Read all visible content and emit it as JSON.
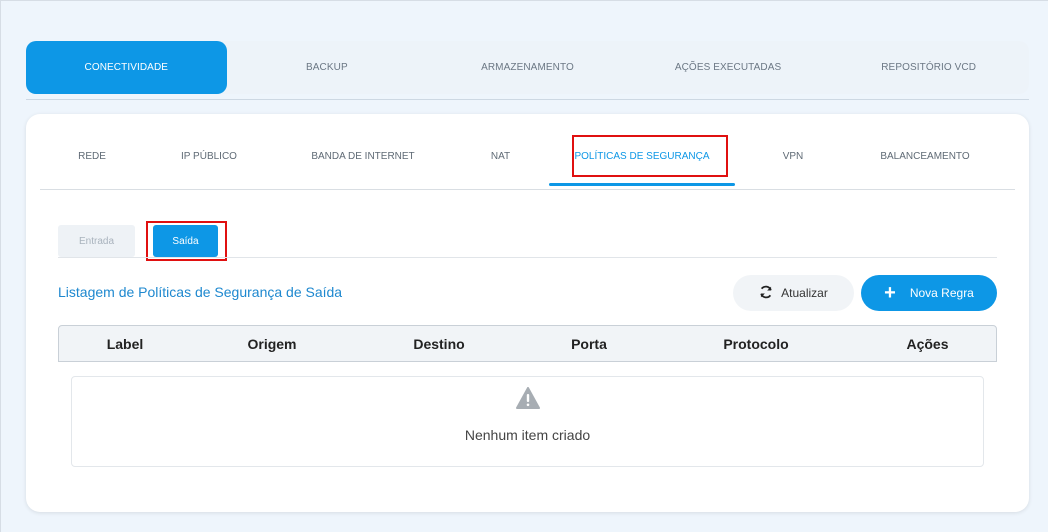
{
  "top_tabs": [
    "CONECTIVIDADE",
    "BACKUP",
    "ARMAZENAMENTO",
    "AÇÕES EXECUTADAS",
    "REPOSITÓRIO VCD"
  ],
  "sub_tabs": [
    "REDE",
    "IP PÚBLICO",
    "BANDA DE INTERNET",
    "NAT",
    "POLÍTICAS DE SEGURANÇA",
    "VPN",
    "BALANCEAMENTO"
  ],
  "direction": {
    "entrada": "Entrada",
    "saida": "Saída"
  },
  "list": {
    "title": "Listagem de Políticas de Segurança de Saída"
  },
  "buttons": {
    "refresh": "Atualizar",
    "new_rule": "Nova Regra"
  },
  "table": {
    "headers": [
      "Label",
      "Origem",
      "Destino",
      "Porta",
      "Protocolo",
      "Ações"
    ],
    "empty_text": "Nenhum item criado"
  },
  "colors": {
    "accent": "#0d97e6",
    "highlight": "#e01010"
  }
}
